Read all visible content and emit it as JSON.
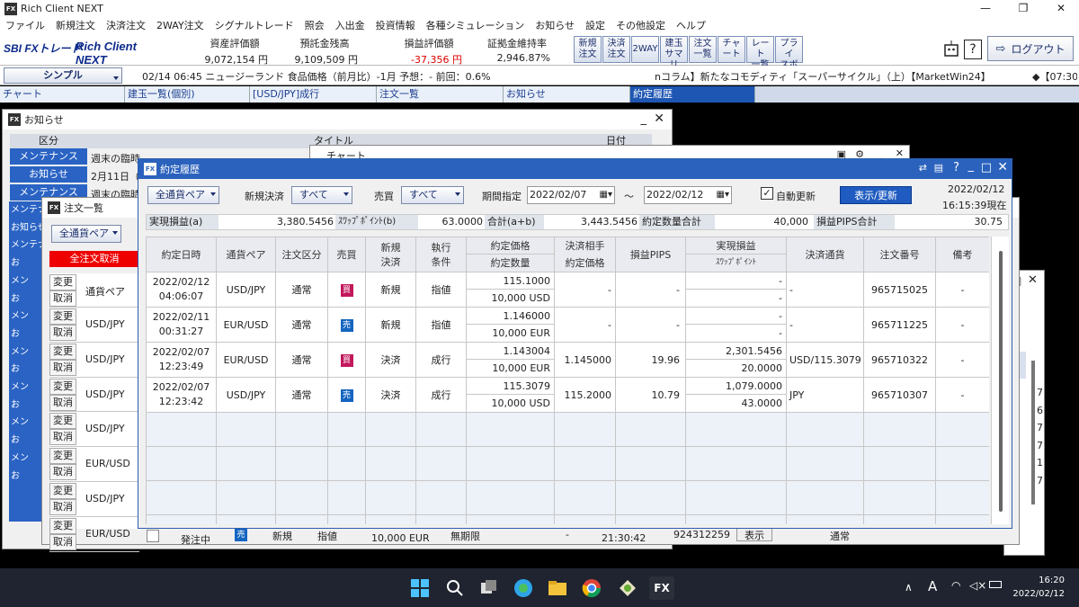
{
  "app": {
    "title": "Rich Client NEXT",
    "fx_icon": "FX"
  },
  "menu": [
    "ファイル",
    "新規注文",
    "決済注文",
    "2WAY注文",
    "シグナルトレード",
    "照会",
    "入出金",
    "投資情報",
    "各種シミュレーション",
    "お知らせ",
    "設定",
    "その他設定",
    "ヘルプ"
  ],
  "header": {
    "logo_left": "SBI FXトレード",
    "logo_right": "Rich Client NEXT",
    "account": [
      {
        "label": "資産評価額",
        "value": "9,072,154 円"
      },
      {
        "label": "預託金残高",
        "value": "9,109,509 円"
      },
      {
        "label": "損益評価額",
        "value": "-37,356 円"
      },
      {
        "label": "証拠金維持率",
        "value": "2,946.87%"
      }
    ],
    "buttons": [
      "新規\n注文",
      "決済\n注文",
      "2WAY",
      "建玉\nサマリ",
      "注文\n一覧",
      "チャ\nート",
      "レート\n一覧",
      "プライ\nスボ"
    ],
    "logout": "ログアウト"
  },
  "ticker": {
    "view": "シンプル",
    "news1": "02/14 06:45 ニュージーランド 食品価格（前月比）-1月 予想：- 前回：0.6%",
    "news2": "nコラム】新たなコモディティ「スーパーサイクル」（上）【MarketWin24】",
    "news3": "◆【07:30"
  },
  "tabs": [
    "チャート",
    "建玉一覧(個別)",
    "[USD/JPY]成行",
    "注文一覧",
    "お知らせ",
    "約定履歴"
  ],
  "notice_window": {
    "title": "お知らせ",
    "col_category": "区分",
    "col_title": "タイトル",
    "col_date": "日付",
    "rows": [
      {
        "cat": "メンテナンス",
        "text": "週末の臨時"
      },
      {
        "cat": "お知らせ",
        "text": "2月11日（"
      },
      {
        "cat": "メンテナンス",
        "text": "週末の臨時"
      }
    ]
  },
  "chart_window": {
    "title": "チャート"
  },
  "order_list_window": {
    "title": "注文一覧",
    "pair_select": "全通貨ペア",
    "cancel_all": "全注文取消",
    "col_change": "変更",
    "col_cancel": "取消",
    "col_pair": "通貨ペア",
    "rows": [
      "USD/JPY",
      "USD/JPY",
      "USD/JPY",
      "USD/JPY",
      "EUR/USD",
      "USD/JPY",
      "EUR/USD"
    ],
    "bottom_row": {
      "status": "発注中",
      "badge": "売",
      "type": "新規",
      "cond": "指値",
      "amount": "10,000 EUR",
      "expiry": "無期限",
      "dash": "-",
      "time": "21:30:42",
      "order_no": "924312259",
      "show": "表示",
      "kind": "通常"
    }
  },
  "side_labels": [
    "メンテナンス",
    "お知らせ",
    "メンテナンス",
    "お",
    "メン",
    "お",
    "メン",
    "お",
    "メン",
    "お",
    "メン",
    "お",
    "メン",
    "お",
    "メン",
    "お"
  ],
  "right_window": {
    "numbers": [
      "7",
      "6",
      "7",
      "7",
      "1",
      "7"
    ]
  },
  "history": {
    "title": "約定履歴",
    "pair_select": "全通貨ペア",
    "settle_label": "新規決済",
    "settle_value": "すべて",
    "side_label": "売買",
    "side_value": "すべて",
    "period_label": "期間指定",
    "date_from": "2022/02/07",
    "tilde": "～",
    "date_to": "2022/02/12",
    "auto_update": "自動更新",
    "refresh": "表示/更新",
    "as_of_date": "2022/02/12",
    "as_of_time": "16:15:39現在",
    "summary": [
      {
        "label": "実現損益(a)",
        "value": "3,380.5456"
      },
      {
        "label": "ｽﾜｯﾌﾟﾎﾟｲﾝﾄ(b)",
        "value": "63.0000"
      },
      {
        "label": "合計(a+b)",
        "value": "3,443.5456"
      },
      {
        "label": "約定数量合計",
        "value": "40,000"
      },
      {
        "label": "損益PIPS合計",
        "value": "30.75"
      }
    ],
    "columns": {
      "date": "約定日時",
      "pair": "通貨ペア",
      "kind": "注文区分",
      "side": "売買",
      "new_settle": "新規\n決済",
      "cond": "執行\n条件",
      "price": "約定価格",
      "qty": "約定数量",
      "counter_top": "決済相手",
      "counter_bottom": "約定価格",
      "pips": "損益PIPS",
      "pnl": "実現損益",
      "swap": "ｽﾜｯﾌﾟﾎﾟｲﾝﾄ",
      "currency": "決済通貨",
      "order_no": "注文番号",
      "note": "備考"
    },
    "rows": [
      {
        "date": "2022/02/12",
        "time": "04:06:07",
        "pair": "USD/JPY",
        "kind": "通常",
        "side": "買",
        "side_color": "#c2185b",
        "ns": "新規",
        "cond": "指値",
        "price": "115.1000",
        "qty": "10,000 USD",
        "counter": "-",
        "pips": "-",
        "pnl": "-",
        "swap": "-",
        "currency": "-",
        "order_no": "965715025",
        "note": "-"
      },
      {
        "date": "2022/02/11",
        "time": "00:31:27",
        "pair": "EUR/USD",
        "kind": "通常",
        "side": "売",
        "side_color": "#1565c0",
        "ns": "新規",
        "cond": "指値",
        "price": "1.146000",
        "qty": "10,000 EUR",
        "counter": "-",
        "pips": "-",
        "pnl": "-",
        "swap": "-",
        "currency": "-",
        "order_no": "965711225",
        "note": "-"
      },
      {
        "date": "2022/02/07",
        "time": "12:23:49",
        "pair": "EUR/USD",
        "kind": "通常",
        "side": "買",
        "side_color": "#c2185b",
        "ns": "決済",
        "cond": "成行",
        "price": "1.143004",
        "qty": "10,000 EUR",
        "counter": "1.145000",
        "pips": "19.96",
        "pnl": "2,301.5456",
        "swap": "20.0000",
        "currency": "USD/115.3079",
        "order_no": "965710322",
        "note": "-"
      },
      {
        "date": "2022/02/07",
        "time": "12:23:42",
        "pair": "USD/JPY",
        "kind": "通常",
        "side": "売",
        "side_color": "#1565c0",
        "ns": "決済",
        "cond": "成行",
        "price": "115.3079",
        "qty": "10,000 USD",
        "counter": "115.2000",
        "pips": "10.79",
        "pnl": "1,079.0000",
        "swap": "43.0000",
        "currency": "JPY",
        "order_no": "965710307",
        "note": "-"
      }
    ]
  },
  "taskbar": {
    "time": "16:20",
    "date": "2022/02/12",
    "ime": "A"
  }
}
